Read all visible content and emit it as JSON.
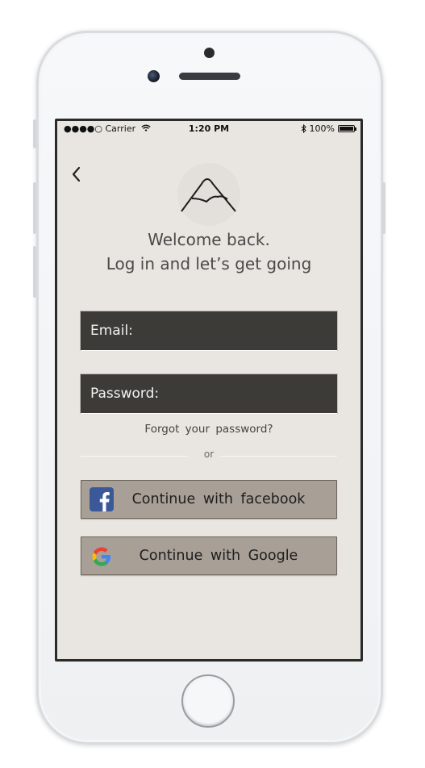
{
  "status_bar": {
    "carrier": "●●●●○ Carrier",
    "time": "1:20 PM",
    "battery": "100%"
  },
  "header": {
    "line1": "Welcome back.",
    "line2": "Log in and let’s get going"
  },
  "form": {
    "email_label": "Email:",
    "password_label": "Password:",
    "forgot_link": "Forgot your password?",
    "divider_text": "or"
  },
  "social": {
    "facebook_label": "Continue with facebook",
    "google_label": "Continue with Google"
  },
  "icons": {
    "back": "chevron-left-icon",
    "logo": "mountain-logo-icon",
    "facebook": "facebook-icon",
    "google": "google-icon"
  },
  "colors": {
    "screen_bg": "#e9e5e0",
    "field_bg": "#3d3b38",
    "social_bg": "#a89f96",
    "text_dark": "#4a4a4a"
  }
}
